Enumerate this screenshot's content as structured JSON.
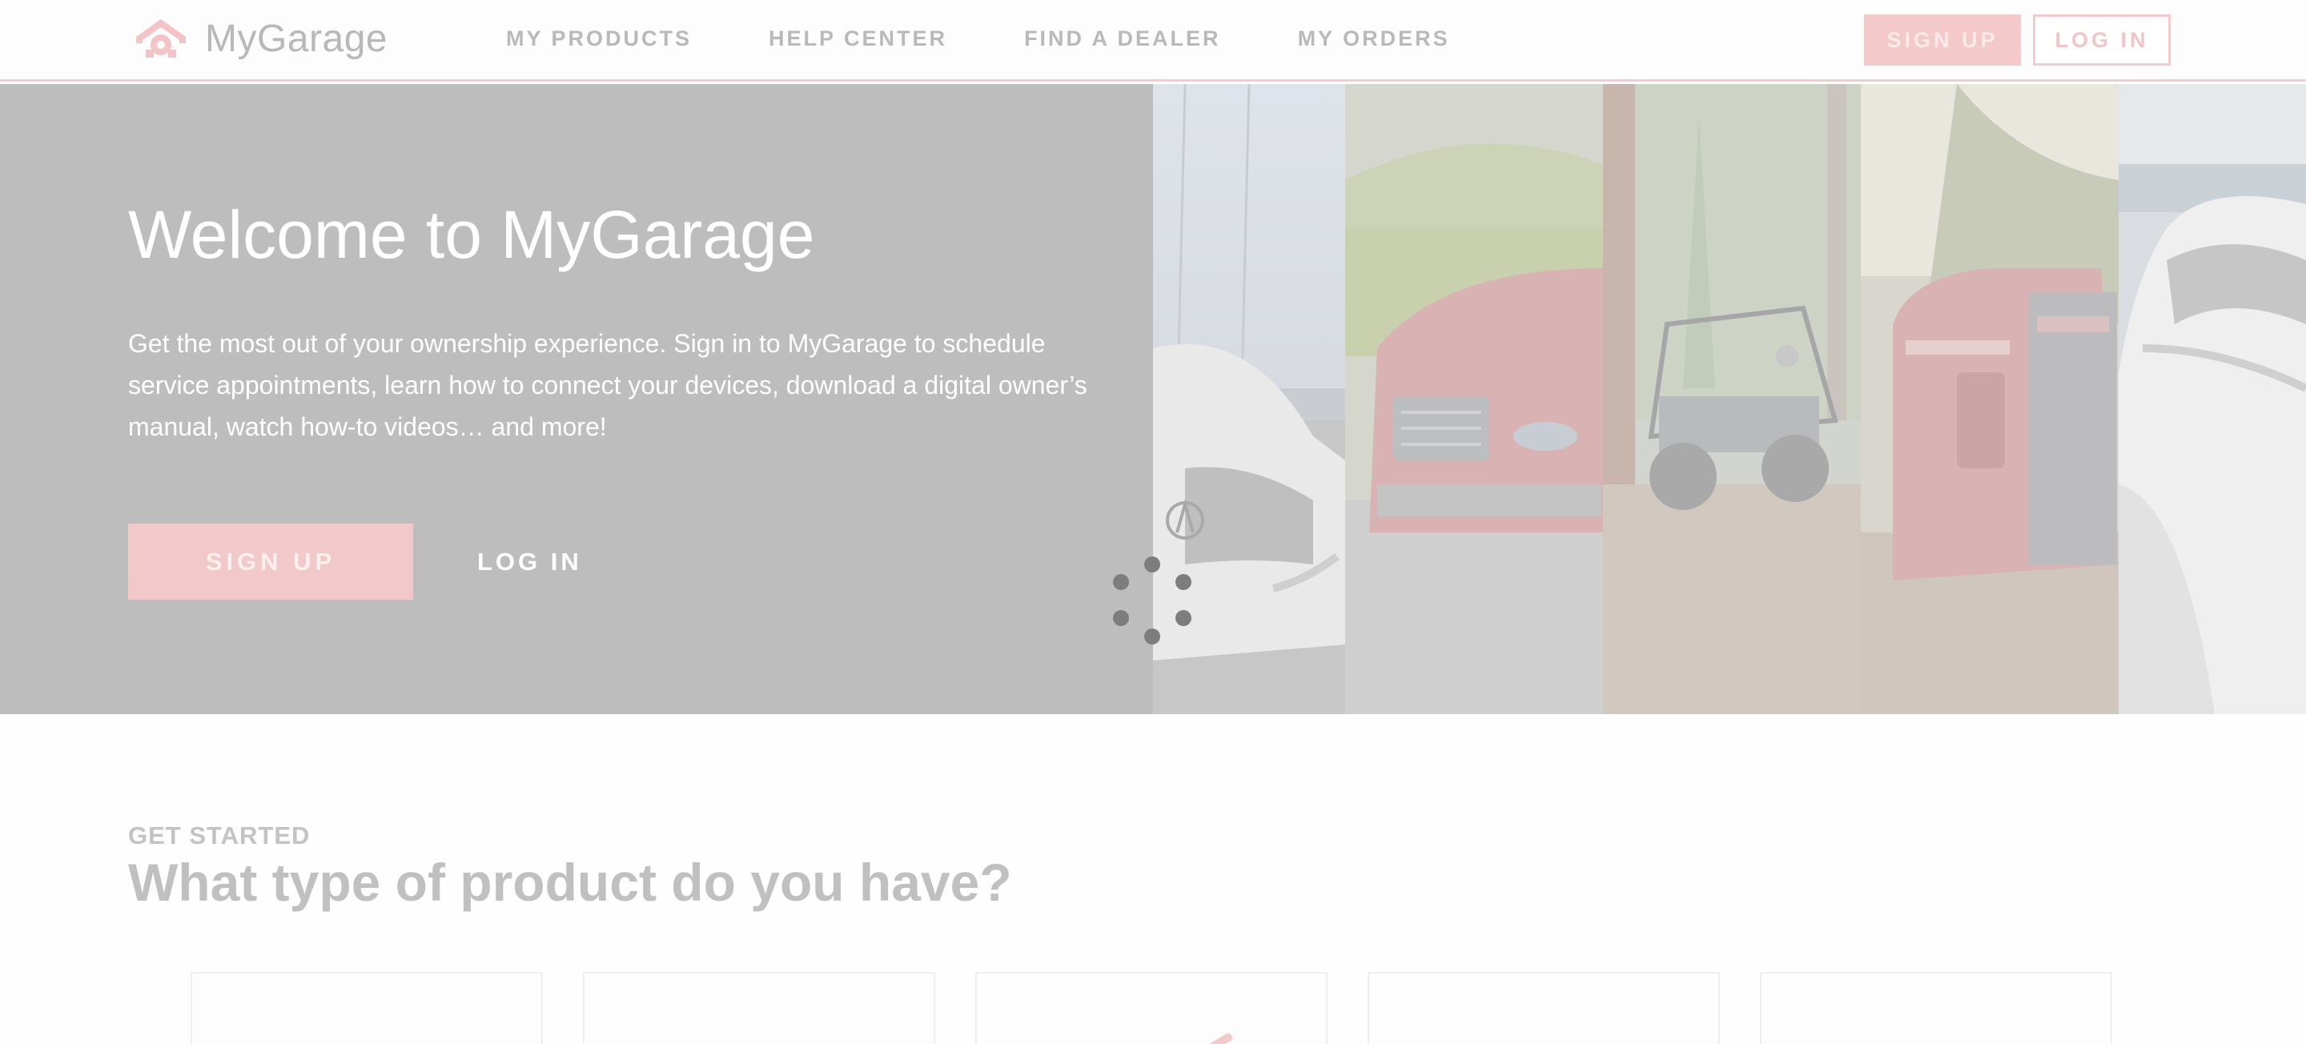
{
  "header": {
    "brand": "MyGarage",
    "nav": [
      "MY PRODUCTS",
      "HELP CENTER",
      "FIND A DEALER",
      "MY ORDERS"
    ],
    "signup_label": "SIGN UP",
    "login_label": "LOG IN"
  },
  "hero": {
    "title": "Welcome to MyGarage",
    "description": "Get the most out of your ownership experience. Sign in to MyGarage to schedule service appointments, learn how to connect your devices, download a digital owner’s manual, watch how-to videos… and more!",
    "signup_label": "SIGN UP",
    "login_label": "LOG IN",
    "product_images": [
      "acura-car",
      "honda-suv",
      "honda-utv",
      "honda-generator",
      "honda-outboard-motor"
    ]
  },
  "get_started": {
    "eyebrow": "GET STARTED",
    "title": "What type of product do you have?"
  },
  "colors": {
    "accent": "#f2c9ca",
    "hero_overlay": "#bdbdbd",
    "nav_text": "#b9b9b9"
  }
}
